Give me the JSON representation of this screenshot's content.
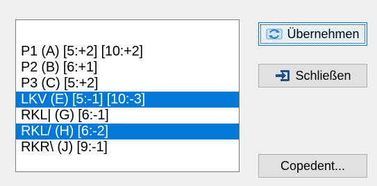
{
  "listbox": {
    "items": [
      {
        "label": "P1 (A) [5:+2] [10:+2]",
        "selected": false
      },
      {
        "label": "P2 (B) [6:+1]",
        "selected": false
      },
      {
        "label": "P3 (C) [5:+2]",
        "selected": false
      },
      {
        "label": "LKV (E) [5:-1] [10:-3]",
        "selected": true
      },
      {
        "label": "RKL| (G) [6:-1]",
        "selected": false
      },
      {
        "label": "RKL/ (H) [6:-2]",
        "selected": true
      },
      {
        "label": "RKR\\ (J) [9:-1]",
        "selected": false
      }
    ]
  },
  "buttons": {
    "apply_label": "Übernehmen",
    "apply_icon": "refresh-arrows-icon",
    "close_label": "Schließen",
    "close_icon": "exit-door-icon",
    "copedent_label": "Copedent..."
  },
  "colors": {
    "selection": "#0078d7",
    "window_bg": "#f0f0f0",
    "close_icon": "#1f4e8c"
  }
}
